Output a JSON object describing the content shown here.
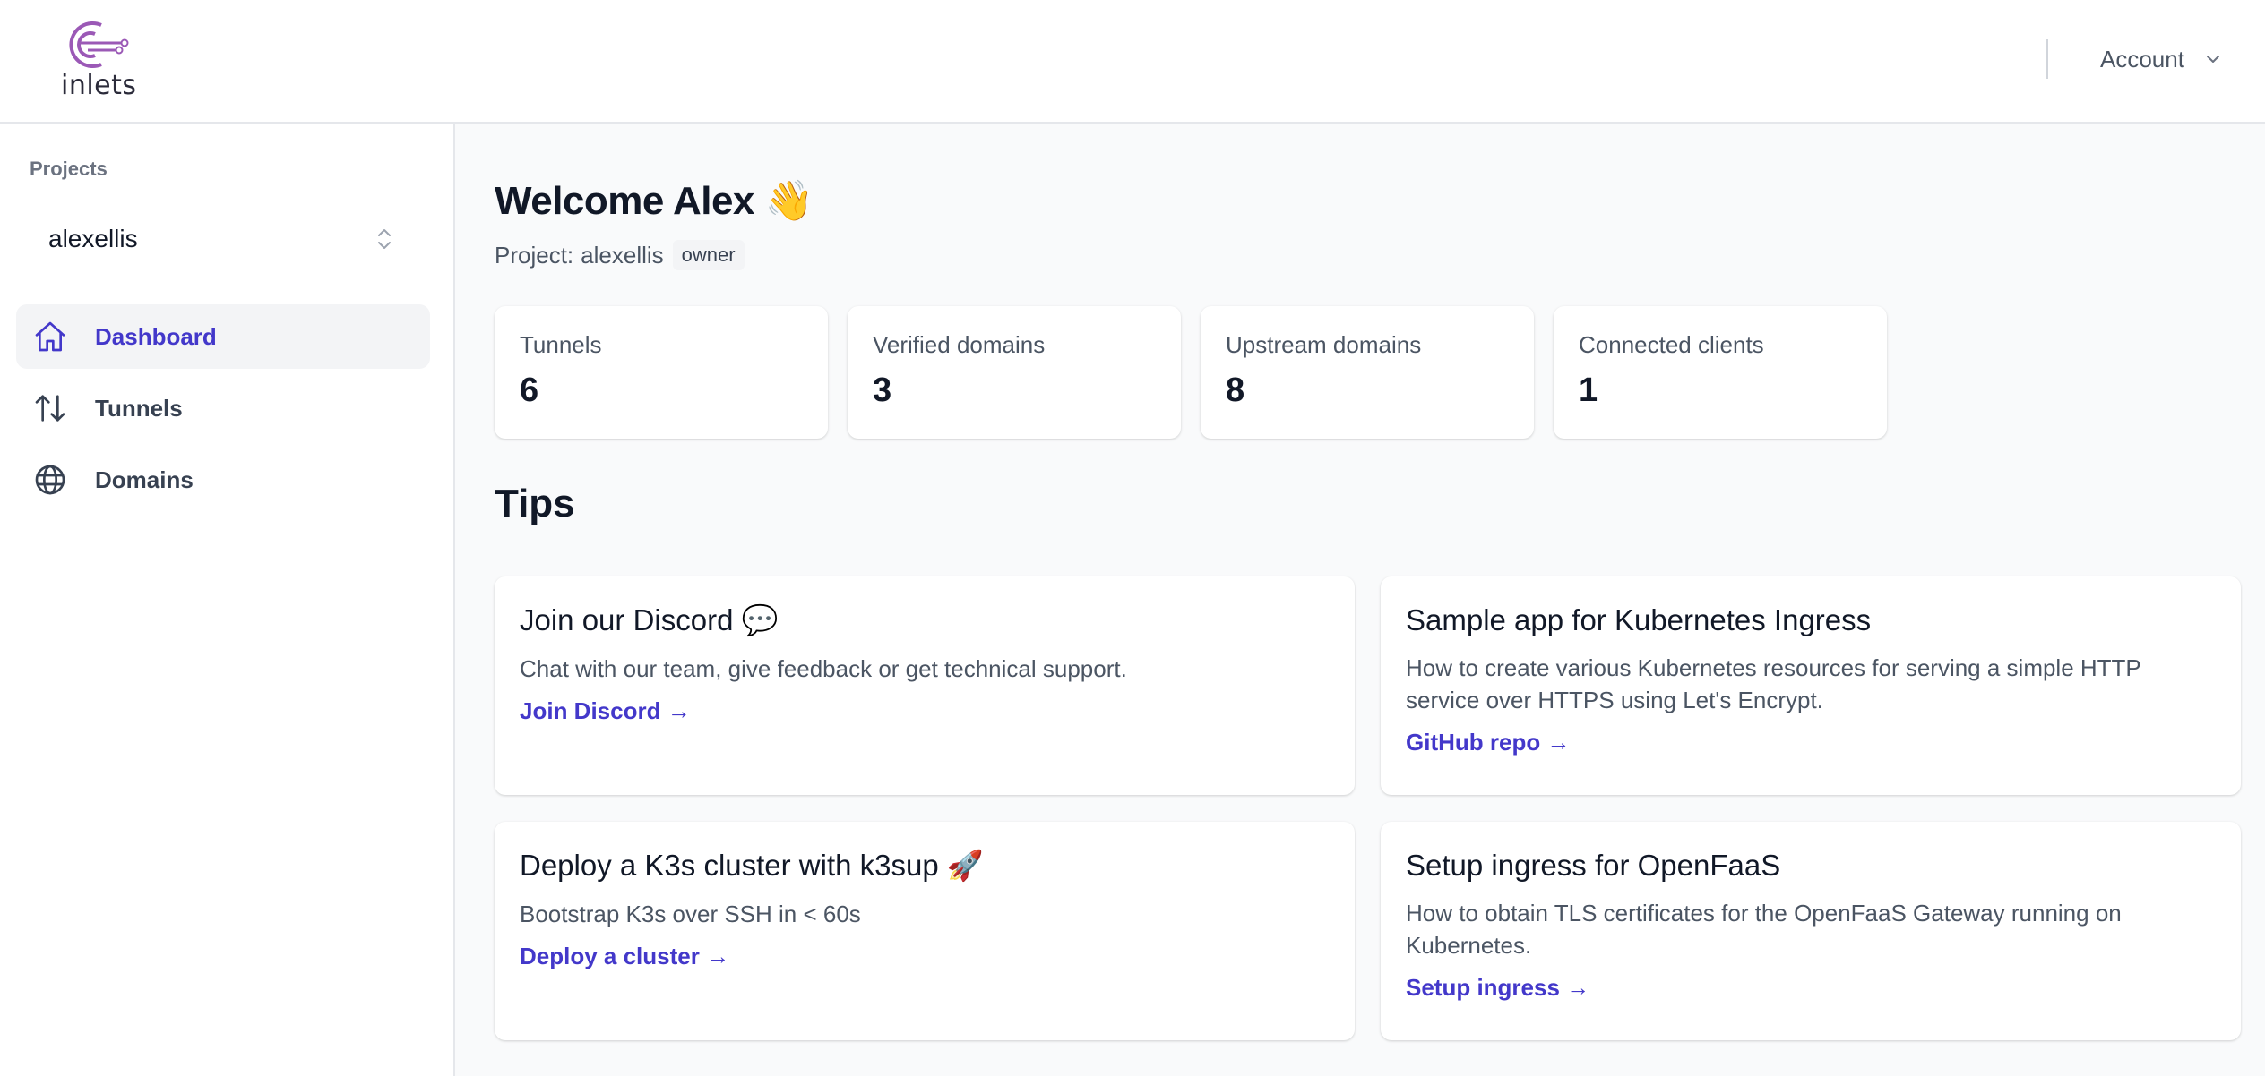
{
  "header": {
    "logo_text": "inlets",
    "account_label": "Account"
  },
  "sidebar": {
    "projects_label": "Projects",
    "selected_project": "alexellis",
    "items": [
      {
        "label": "Dashboard",
        "icon": "home-icon",
        "active": true
      },
      {
        "label": "Tunnels",
        "icon": "arrows-up-down-icon",
        "active": false
      },
      {
        "label": "Domains",
        "icon": "globe-icon",
        "active": false
      }
    ]
  },
  "main": {
    "welcome": "Welcome Alex 👋",
    "project_prefix": "Project:",
    "project_name": "alexellis",
    "role_badge": "owner",
    "stats": [
      {
        "label": "Tunnels",
        "value": "6"
      },
      {
        "label": "Verified domains",
        "value": "3"
      },
      {
        "label": "Upstream domains",
        "value": "8"
      },
      {
        "label": "Connected clients",
        "value": "1"
      }
    ],
    "tips_title": "Tips",
    "tips": [
      {
        "title": "Join our Discord 💬",
        "description": "Chat with our team, give feedback or get technical support.",
        "link": "Join Discord →"
      },
      {
        "title": "Sample app for Kubernetes Ingress",
        "description": "How to create various Kubernetes resources for serving a simple HTTP service over HTTPS using Let's Encrypt.",
        "link": "GitHub repo →"
      },
      {
        "title": "Deploy a K3s cluster with k3sup 🚀",
        "description": "Bootstrap K3s over SSH in < 60s",
        "link": "Deploy a cluster →"
      },
      {
        "title": "Setup ingress for OpenFaaS",
        "description": "How to obtain TLS certificates for the OpenFaaS Gateway running on Kubernetes.",
        "link": "Setup ingress →"
      }
    ]
  },
  "colors": {
    "accent": "#4338ca",
    "logo_purple": "#9b59b6",
    "background": "#f9fafb"
  }
}
